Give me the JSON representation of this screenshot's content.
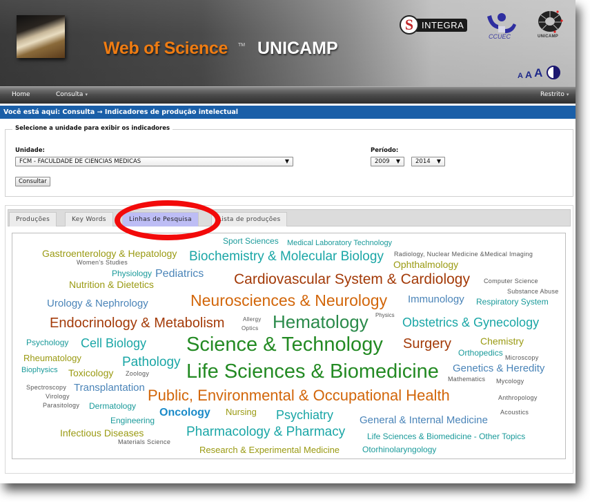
{
  "header": {
    "title_main": "Web of Science",
    "title_tm": "TM",
    "title_org": "UNICAMP",
    "logos": {
      "integra_s": "S",
      "integra": "INTEGRA",
      "ccuec": "CCUEC",
      "unicamp": "UNICAMP"
    },
    "accessibility": {
      "font_small": "A",
      "font_medium": "A",
      "font_large": "A",
      "contrast_icon": "contrast-icon"
    }
  },
  "nav": {
    "home": "Home",
    "consulta": "Consulta",
    "restrito": "Restrito",
    "caret": "▾"
  },
  "breadcrumb": "Você está aqui:  Consulta → Indicadores de produção intelectual",
  "form": {
    "legend": "Selecione a unidade para exibir os indicadores",
    "unidade_label": "Unidade:",
    "unidade_value": "FCM - FACULDADE DE CIENCIAS MEDICAS",
    "periodo_label": "Período:",
    "periodo_start": "2009",
    "periodo_end": "2014",
    "arrow": "▼",
    "submit": "Consultar"
  },
  "tabs": [
    {
      "label": "Produções",
      "active": false
    },
    {
      "label": "Key Words",
      "active": false
    },
    {
      "label": "Linhas de Pesquisa",
      "active": true
    },
    {
      "label": "Lista de produções",
      "active": false
    }
  ],
  "colors": {
    "breadcrumb_bg": "#1a5fa8",
    "title_orange": "#ef7c12",
    "highlight_ring": "#f20a0a",
    "active_tab": "#bdbdf5"
  },
  "word_cloud": [
    {
      "text": "Sport Sciences",
      "color": "#1a9a9a"
    },
    {
      "text": "Medical Laboratory Technology",
      "color": "#1a9a9a"
    },
    {
      "text": "Gastroenterology & Hepatology",
      "color": "#9a9a12"
    },
    {
      "text": "Biochemistry & Molecular Biology",
      "color": "#1aa6a6"
    },
    {
      "text": "Radiology, Nuclear Medicine &Medical Imaging",
      "color": "#555555"
    },
    {
      "text": "Women's Studies",
      "color": "#555555"
    },
    {
      "text": "Ophthalmology",
      "color": "#9a9a12"
    },
    {
      "text": "Physiology",
      "color": "#1a9a9a"
    },
    {
      "text": "Pediatrics",
      "color": "#4a84b8"
    },
    {
      "text": "Cardiovascular System & Cardiology",
      "color": "#a33a08"
    },
    {
      "text": "Nutrition & Dietetics",
      "color": "#9a9a12"
    },
    {
      "text": "Computer Science",
      "color": "#555555"
    },
    {
      "text": "Substance Abuse",
      "color": "#555555"
    },
    {
      "text": "Urology & Nephrology",
      "color": "#4a84b8"
    },
    {
      "text": "Neurosciences & Neurology",
      "color": "#d2660a"
    },
    {
      "text": "Immunology",
      "color": "#4a84b8"
    },
    {
      "text": "Respiratory System",
      "color": "#1a9a9a"
    },
    {
      "text": "Physics",
      "color": "#555555"
    },
    {
      "text": "Endocrinology & Metabolism",
      "color": "#a33a08"
    },
    {
      "text": "Allergy",
      "color": "#555555"
    },
    {
      "text": "Optics",
      "color": "#555555"
    },
    {
      "text": "Hematology",
      "color": "#2a8a4a"
    },
    {
      "text": "Obstetrics & Gynecology",
      "color": "#1aa6a6"
    },
    {
      "text": "Psychology",
      "color": "#1a9a9a"
    },
    {
      "text": "Cell Biology",
      "color": "#1aa6a6"
    },
    {
      "text": "Science & Technology",
      "color": "#238a23"
    },
    {
      "text": "Surgery",
      "color": "#a33a08"
    },
    {
      "text": "Chemistry",
      "color": "#9a9a12"
    },
    {
      "text": "Rheumatology",
      "color": "#9a9a12"
    },
    {
      "text": "Orthopedics",
      "color": "#1a9a9a"
    },
    {
      "text": "Microscopy",
      "color": "#555555"
    },
    {
      "text": "Pathology",
      "color": "#1aa6a6"
    },
    {
      "text": "Biophysics",
      "color": "#1a9a9a"
    },
    {
      "text": "Toxicology",
      "color": "#9a9a12"
    },
    {
      "text": "Zoology",
      "color": "#555555"
    },
    {
      "text": "Life Sciences & Biomedicine",
      "color": "#238a23"
    },
    {
      "text": "Genetics & Heredity",
      "color": "#4a84b8"
    },
    {
      "text": "Mathematics",
      "color": "#555555"
    },
    {
      "text": "Mycology",
      "color": "#555555"
    },
    {
      "text": "Spectroscopy",
      "color": "#555555"
    },
    {
      "text": "Transplantation",
      "color": "#4a84b8"
    },
    {
      "text": "Virology",
      "color": "#555555"
    },
    {
      "text": "Public, Environmental & Occupational Health",
      "color": "#d2660a"
    },
    {
      "text": "Anthropology",
      "color": "#555555"
    },
    {
      "text": "Parasitology",
      "color": "#555555"
    },
    {
      "text": "Dermatology",
      "color": "#1a9a9a"
    },
    {
      "text": "Oncology",
      "color": "#1a8ac8"
    },
    {
      "text": "Nursing",
      "color": "#9a9a12"
    },
    {
      "text": "Psychiatry",
      "color": "#1aa6a6"
    },
    {
      "text": "Acoustics",
      "color": "#555555"
    },
    {
      "text": "Engineering",
      "color": "#1a9a9a"
    },
    {
      "text": "General & Internal Medicine",
      "color": "#4a84b8"
    },
    {
      "text": "Infectious Diseases",
      "color": "#9a9a12"
    },
    {
      "text": "Pharmacology & Pharmacy",
      "color": "#1aa6a6"
    },
    {
      "text": "Life Sciences & Biomedicine - Other Topics",
      "color": "#1a9a9a"
    },
    {
      "text": "Materials Science",
      "color": "#555555"
    },
    {
      "text": "Research & Experimental Medicine",
      "color": "#9a9a12"
    },
    {
      "text": "Otorhinolaryngology",
      "color": "#1a9a9a"
    }
  ]
}
